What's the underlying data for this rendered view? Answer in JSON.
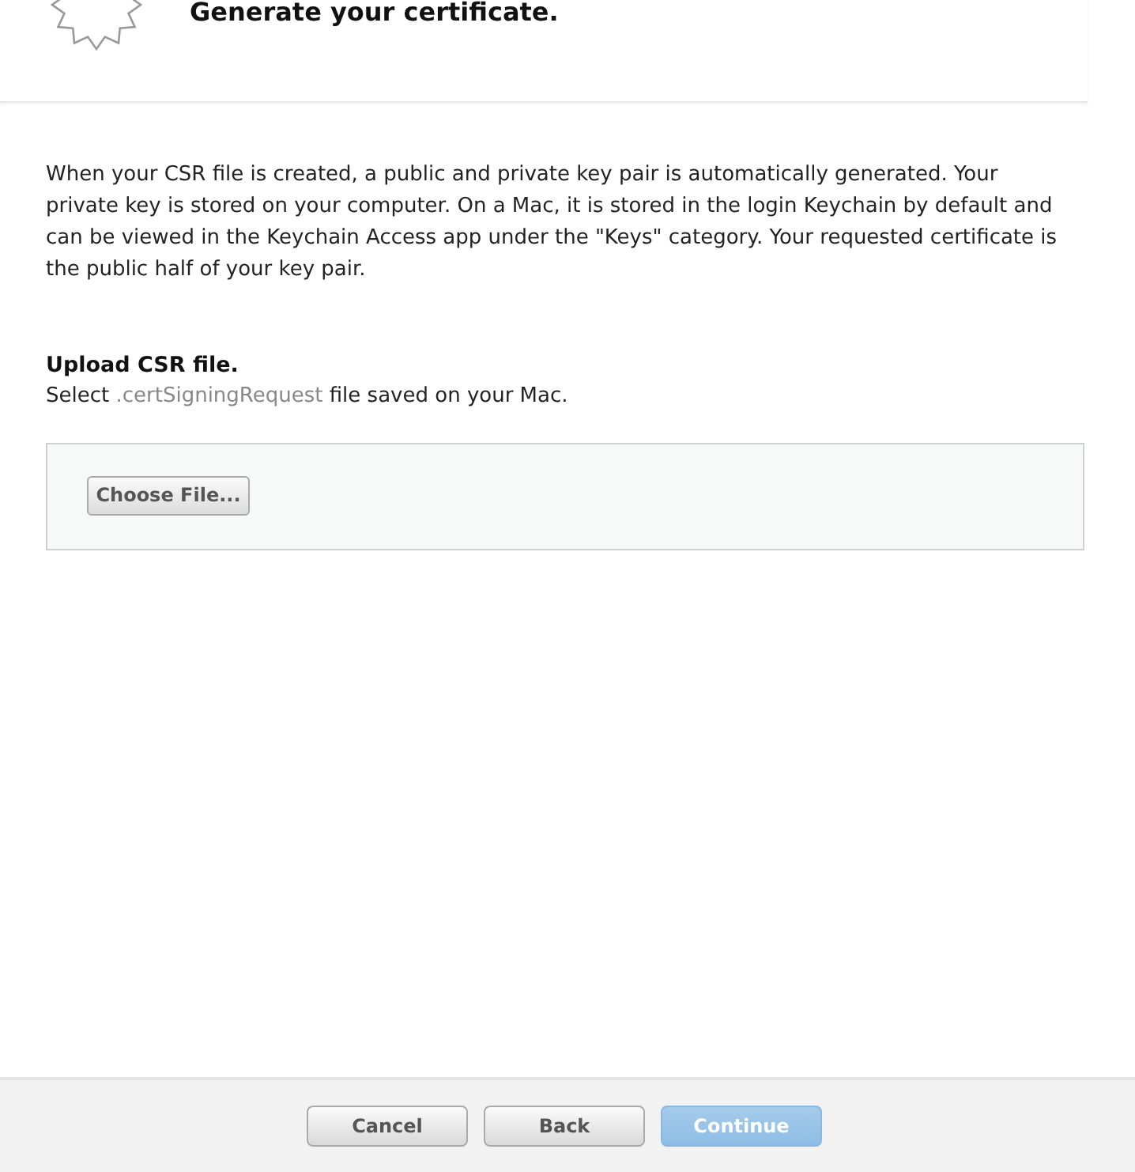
{
  "header": {
    "title": "Generate your certificate."
  },
  "intro": "When your CSR file is created, a public and private key pair is automatically generated. Your private key is stored on your computer. On a Mac, it is stored in the login Keychain by default and can be viewed in the Keychain Access app under the \"Keys\" category. Your requested certificate is the public half of your key pair.",
  "upload": {
    "heading": "Upload CSR file.",
    "hint_before": "Select ",
    "hint_file_type": ".certSigningRequest",
    "hint_after": " file saved on your Mac.",
    "button": "Choose File..."
  },
  "footer": {
    "buttons": [
      {
        "label": "Cancel",
        "kind": "plain",
        "disabled": false
      },
      {
        "label": "Back",
        "kind": "plain",
        "disabled": false
      },
      {
        "label": "Continue",
        "kind": "primary",
        "disabled": true
      }
    ]
  }
}
